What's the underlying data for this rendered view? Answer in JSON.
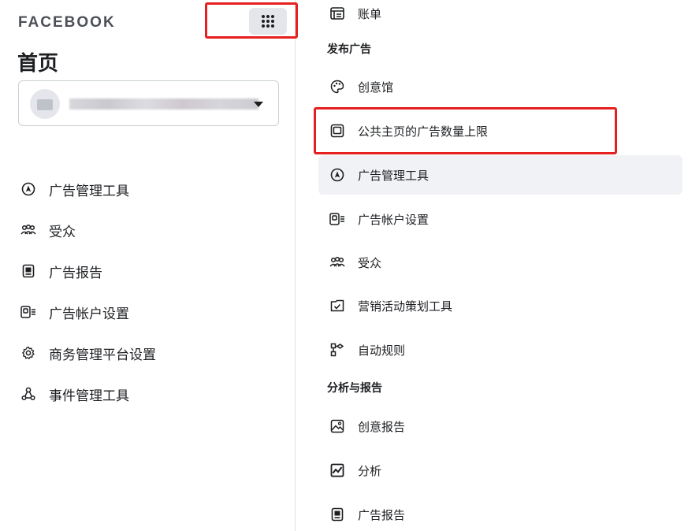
{
  "brand": "FACEBOOK",
  "page_title": "首页",
  "left_nav": [
    {
      "label": "广告管理工具",
      "icon": "ads-manager-icon"
    },
    {
      "label": "受众",
      "icon": "audience-icon"
    },
    {
      "label": "广告报告",
      "icon": "ads-reporting-icon"
    },
    {
      "label": "广告帐户设置",
      "icon": "ad-account-settings-icon"
    },
    {
      "label": "商务管理平台设置",
      "icon": "gear-icon"
    },
    {
      "label": "事件管理工具",
      "icon": "events-manager-icon"
    }
  ],
  "menu": {
    "top_item": {
      "label": "账单",
      "icon": "billing-icon"
    },
    "section_advertise": {
      "title": "发布广告",
      "items": [
        {
          "label": "创意馆",
          "icon": "palette-icon"
        },
        {
          "label": "公共主页的广告数量上限",
          "icon": "page-limit-icon"
        },
        {
          "label": "广告管理工具",
          "icon": "ads-manager-icon",
          "active": true
        },
        {
          "label": "广告帐户设置",
          "icon": "ad-account-settings-icon"
        },
        {
          "label": "受众",
          "icon": "audience-icon"
        },
        {
          "label": "营销活动策划工具",
          "icon": "campaign-planner-icon"
        },
        {
          "label": "自动规则",
          "icon": "automated-rules-icon"
        }
      ]
    },
    "section_analyze": {
      "title": "分析与报告",
      "items": [
        {
          "label": "创意报告",
          "icon": "creative-report-icon"
        },
        {
          "label": "分析",
          "icon": "analytics-icon"
        },
        {
          "label": "广告报告",
          "icon": "ads-reporting-icon"
        }
      ]
    }
  },
  "colors": {
    "highlight": "#e62020",
    "active_bg": "#f0f2f5",
    "text": "#1c1e21"
  }
}
